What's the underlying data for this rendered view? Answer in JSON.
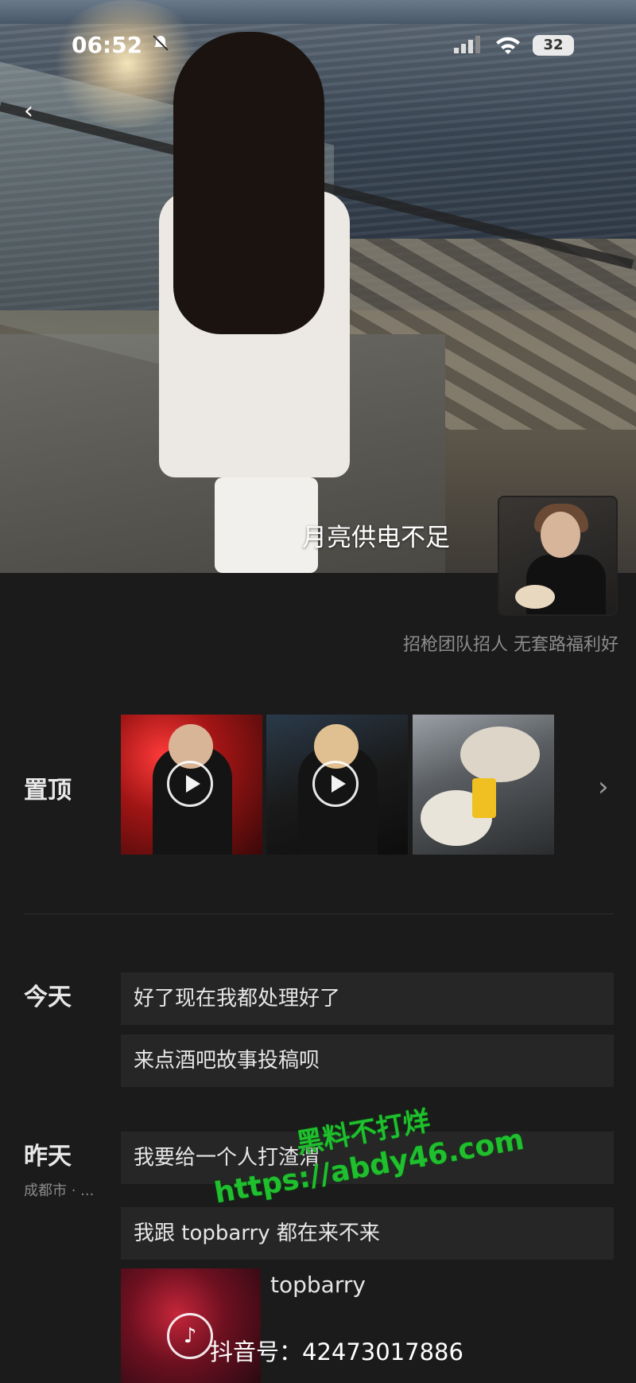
{
  "status_bar": {
    "time": "06:52",
    "battery": "32"
  },
  "profile": {
    "cover_title": "月亮供电不足",
    "bio": "招枪团队招人 无套路福利好"
  },
  "pinned": {
    "label": "置顶",
    "items": [
      {
        "icon": "play-icon"
      },
      {
        "icon": "play-icon"
      },
      {
        "icon": ""
      }
    ]
  },
  "today": {
    "label": "今天",
    "posts": [
      "好了现在我都处理好了",
      "来点酒吧故事投稿呗"
    ]
  },
  "yesterday": {
    "label": "昨天",
    "location": "成都市 · ...",
    "posts": [
      "我要给一个人打渣渭",
      "我跟 topbarry 都在来不来"
    ]
  },
  "share_card": {
    "username": "topbarry",
    "douyin_id": "抖音号：42473017886"
  },
  "watermark": {
    "line1": "黑料不打烊",
    "line2": "https://abdy46.com"
  },
  "colors": {
    "background": "#1b1b1b",
    "row_background": "#262626",
    "watermark_green": "#1fbf2e"
  }
}
